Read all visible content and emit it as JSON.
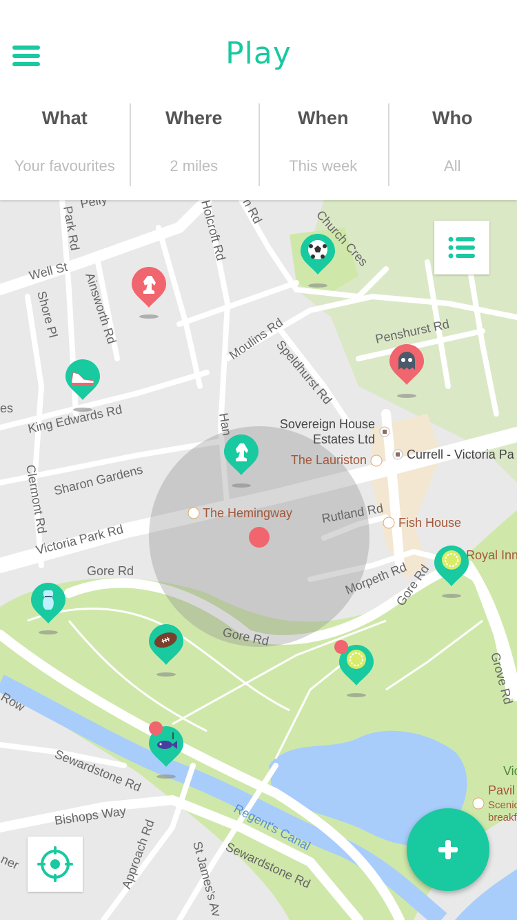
{
  "header": {
    "title": "Play"
  },
  "filters": [
    {
      "label": "What",
      "value": "Your favourites"
    },
    {
      "label": "Where",
      "value": "2 miles"
    },
    {
      "label": "When",
      "value": "This week"
    },
    {
      "label": "Who",
      "value": "All"
    }
  ],
  "map": {
    "streets": {
      "park_rd": "Park Rd",
      "well_st": "Well St",
      "shore_pl": "Shore Pl",
      "ainsworth_rd": "Ainsworth Rd",
      "holcroft_rd": "Holcroft Rd",
      "church_cres": "Church Cres",
      "moulins_rd": "Moulins Rd",
      "speldhurst_rd": "Speldhurst Rd",
      "penshurst_rd": "Penshurst Rd",
      "king_edwards_rd": "King Edwards Rd",
      "sharon_gardens": "Sharon Gardens",
      "clermont_rd": "Clermont Rd",
      "victoria_park_rd": "Victoria Park Rd",
      "rutland_rd": "Rutland Rd",
      "gore_rd_west": "Gore Rd",
      "gore_rd_south": "Gore Rd",
      "gore_rd_east": "Gore Rd",
      "morpeth_rd": "Morpeth Rd",
      "grove_rd": "Grove Rd",
      "sewardstone_rd": "Sewardstone Rd",
      "sewardstone_rd_2": "Sewardstone Rd",
      "bishops_way": "Bishops Way",
      "regents_canal": "Regent's Canal",
      "approach_rd": "Approach Rd",
      "st_james_av": "St James's Av",
      "row": "Row",
      "ner": "ner",
      "pelly": "Pelly",
      "n_rd": "n Rd",
      "han": "Han",
      "es": "es"
    },
    "places": {
      "sovereign_1": "Sovereign House",
      "sovereign_2": "Estates Ltd",
      "lauriston": "The Lauriston",
      "currell": "Currell - Victoria Pa",
      "hemingway": "The Hemingway",
      "fish_house": "Fish House",
      "royal_inn": "Royal Inn",
      "pavil": "Pavil",
      "scenic": "Scenic",
      "breakf": "breakf",
      "vic": "Vic"
    },
    "markers": [
      {
        "name": "chess-marker-red",
        "icon": "chess-knight-icon",
        "color": "#f0656e"
      },
      {
        "name": "football-marker",
        "icon": "football-icon",
        "color": "#19c9a0"
      },
      {
        "name": "running-shoe-marker",
        "icon": "running-shoe-icon",
        "color": "#19c9a0"
      },
      {
        "name": "ghost-marker",
        "icon": "ghost-icon",
        "color": "#f0656e"
      },
      {
        "name": "chess-marker-green",
        "icon": "chess-knight-icon",
        "color": "#19c9a0"
      },
      {
        "name": "tennis-marker-east",
        "icon": "tennis-ball-icon",
        "color": "#19c9a0"
      },
      {
        "name": "bowling-marker",
        "icon": "bowling-pin-icon",
        "color": "#19c9a0"
      },
      {
        "name": "rugby-marker",
        "icon": "rugby-ball-icon",
        "color": "#19c9a0"
      },
      {
        "name": "tennis-marker-park",
        "icon": "tennis-ball-icon",
        "color": "#19c9a0"
      },
      {
        "name": "fishing-marker",
        "icon": "fish-icon",
        "color": "#19c9a0"
      }
    ]
  },
  "colors": {
    "accent": "#19c9a0",
    "alert": "#f0656e",
    "park": "#cfe8aa",
    "water": "#a8cdfa"
  }
}
